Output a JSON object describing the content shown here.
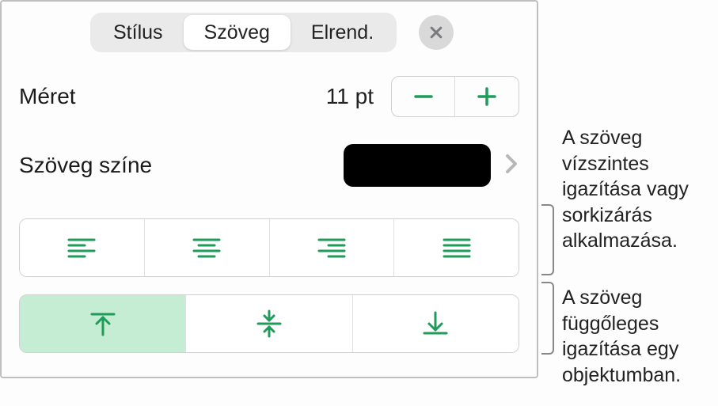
{
  "tabs": {
    "style": "Stílus",
    "text": "Szöveg",
    "arrange": "Elrend."
  },
  "size": {
    "label": "Méret",
    "value": "11 pt"
  },
  "textColor": {
    "label": "Szöveg színe",
    "swatch": "#000000"
  },
  "callouts": {
    "horizontal": "A szöveg vízszintes igazítása vagy sorkizárás alkalmazása.",
    "vertical": "A szöveg függőleges igazítása egy objektumban."
  }
}
